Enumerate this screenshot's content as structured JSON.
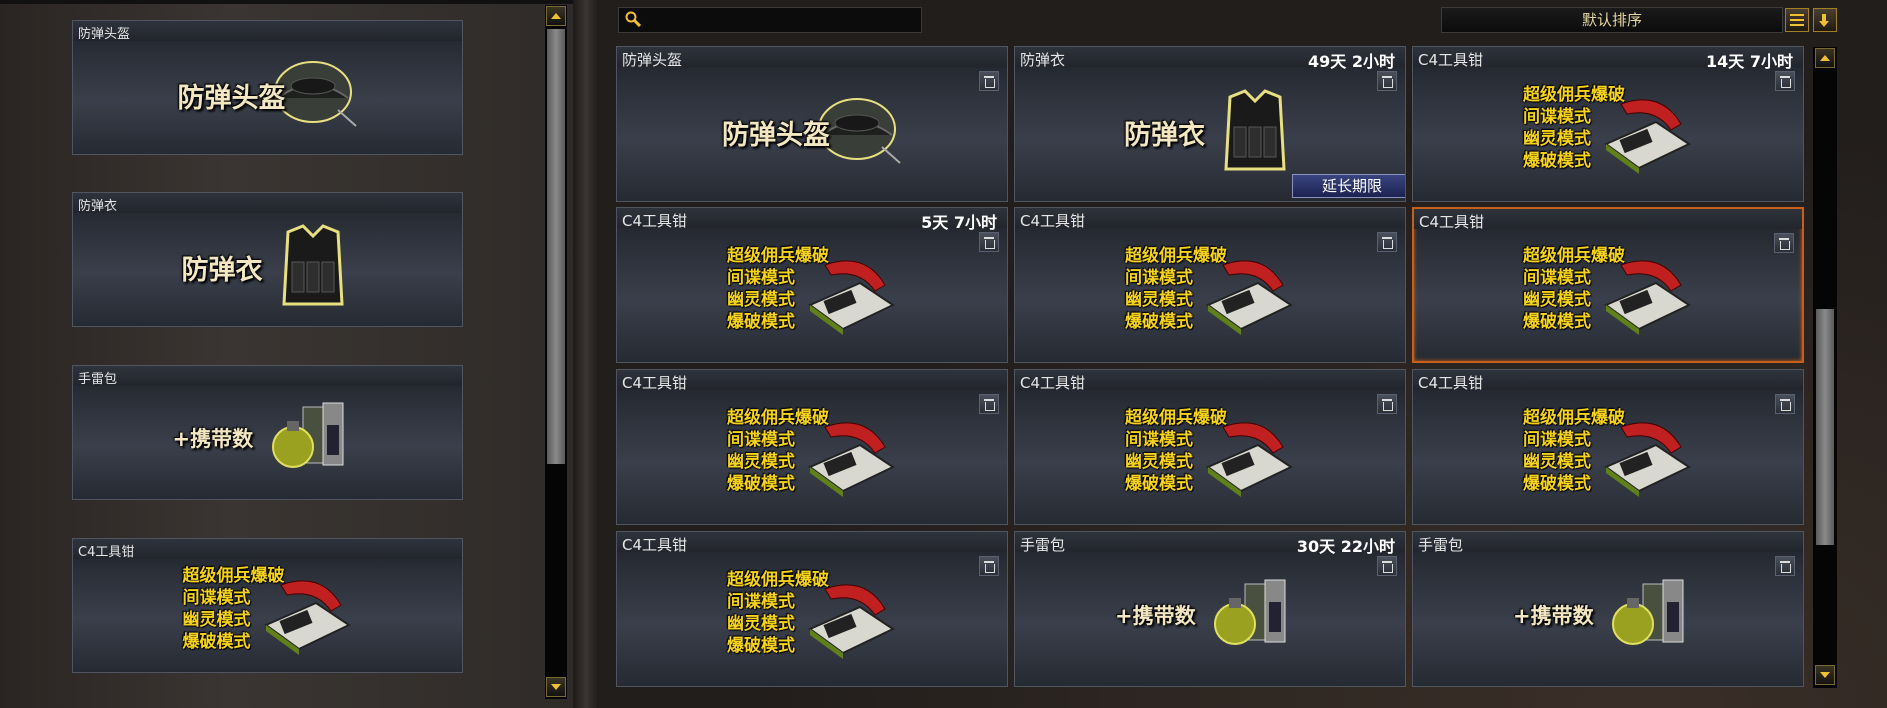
{
  "search": {
    "placeholder": "",
    "value": ""
  },
  "sort": {
    "selected": "默认排序"
  },
  "left_cards": [
    {
      "title": "防弹头盔",
      "art_label": "防弹头盔",
      "kind": "helmet"
    },
    {
      "title": "防弹衣",
      "art_label": "防弹衣",
      "kind": "vest"
    },
    {
      "title": "手雷包",
      "art_label": "+携带数",
      "kind": "grenade"
    },
    {
      "title": "C4工具钳",
      "art_label": "",
      "kind": "c4"
    }
  ],
  "c4_modes": [
    "超级佣兵爆破",
    "间谍模式",
    "幽灵模式",
    "爆破模式"
  ],
  "grid_cards": [
    {
      "title": "防弹头盔",
      "timer": "",
      "art_label": "防弹头盔",
      "kind": "helmet"
    },
    {
      "title": "防弹衣",
      "timer": "49天 2小时",
      "art_label": "防弹衣",
      "kind": "vest",
      "action": "延长期限"
    },
    {
      "title": "C4工具钳",
      "timer": "14天 7小时",
      "art_label": "",
      "kind": "c4"
    },
    {
      "title": "C4工具钳",
      "timer": "5天 7小时",
      "art_label": "",
      "kind": "c4"
    },
    {
      "title": "C4工具钳",
      "timer": "",
      "art_label": "",
      "kind": "c4"
    },
    {
      "title": "C4工具钳",
      "timer": "",
      "art_label": "",
      "kind": "c4",
      "selected": true
    },
    {
      "title": "C4工具钳",
      "timer": "",
      "art_label": "",
      "kind": "c4"
    },
    {
      "title": "C4工具钳",
      "timer": "",
      "art_label": "",
      "kind": "c4"
    },
    {
      "title": "C4工具钳",
      "timer": "",
      "art_label": "",
      "kind": "c4"
    },
    {
      "title": "C4工具钳",
      "timer": "",
      "art_label": "",
      "kind": "c4"
    },
    {
      "title": "手雷包",
      "timer": "30天 22小时",
      "art_label": "+携带数",
      "kind": "grenade"
    },
    {
      "title": "手雷包",
      "timer": "",
      "art_label": "+携带数",
      "kind": "grenade"
    }
  ],
  "colors": {
    "accent": "#f0c030",
    "selected_border": "#c8601a",
    "extend_button": "#2a3470"
  }
}
